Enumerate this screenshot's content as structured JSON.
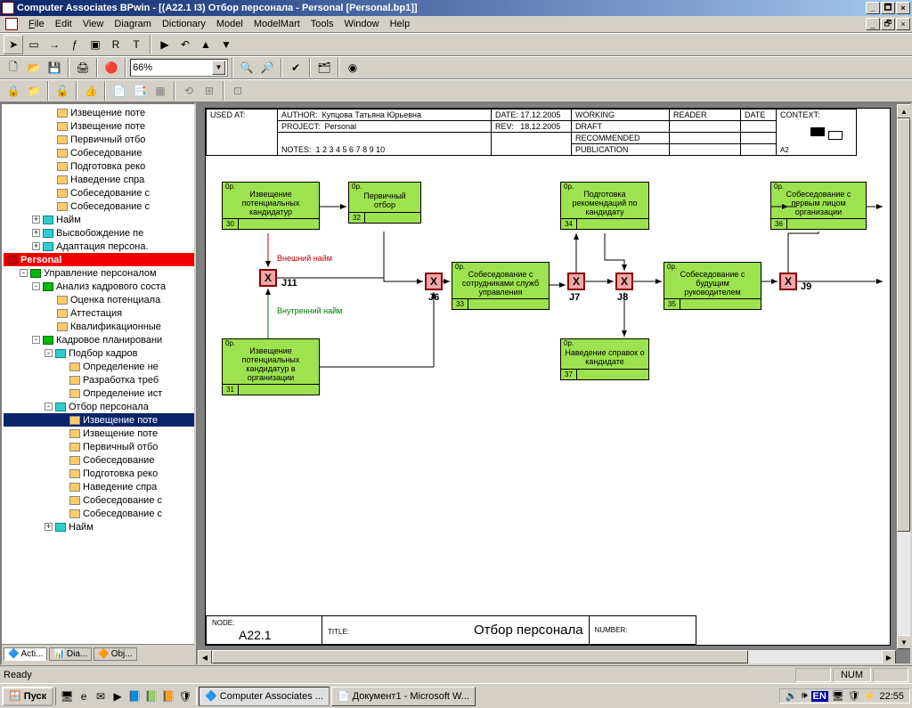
{
  "title": "Computer Associates BPwin - [(A22.1 I3) Отбор персонала - Personal  [Personal.bp1]]",
  "menu": {
    "file": "File",
    "edit": "Edit",
    "view": "View",
    "diagram": "Diagram",
    "dictionary": "Dictionary",
    "model": "Model",
    "modelmart": "ModelMart",
    "tools": "Tools",
    "window": "Window",
    "help": "Help"
  },
  "zoom": "66%",
  "status": {
    "ready": "Ready",
    "num": "NUM"
  },
  "sidebar_tabs": {
    "acti": "Acti...",
    "dia": "Dia...",
    "obj": "Obj..."
  },
  "tree": [
    {
      "indent": 60,
      "icon": "y",
      "label": "Извещение поте"
    },
    {
      "indent": 60,
      "icon": "y",
      "label": "Извещение поте"
    },
    {
      "indent": 60,
      "icon": "y",
      "label": "Первичный отбо"
    },
    {
      "indent": 60,
      "icon": "y",
      "label": "Собеседование"
    },
    {
      "indent": 60,
      "icon": "y",
      "label": "Подготовка реко"
    },
    {
      "indent": 60,
      "icon": "y",
      "label": "Наведение спра"
    },
    {
      "indent": 60,
      "icon": "y",
      "label": "Собеседование с"
    },
    {
      "indent": 60,
      "icon": "y",
      "label": "Собеседование с"
    },
    {
      "indent": 32,
      "pm": "+",
      "icon": "c",
      "label": "Найм"
    },
    {
      "indent": 32,
      "pm": "+",
      "icon": "c",
      "label": "Высвобождение пе"
    },
    {
      "indent": 32,
      "pm": "+",
      "icon": "c",
      "label": "Адаптация персона."
    },
    {
      "indent": 4,
      "icon": "r",
      "label": "Personal",
      "selred": true
    },
    {
      "indent": 18,
      "pm": "-",
      "icon": "g",
      "label": "Управление персоналом"
    },
    {
      "indent": 32,
      "pm": "-",
      "icon": "g",
      "label": "Анализ кадрового соста"
    },
    {
      "indent": 60,
      "icon": "y",
      "label": "Оценка потенциала"
    },
    {
      "indent": 60,
      "icon": "y",
      "label": "Аттестация"
    },
    {
      "indent": 60,
      "icon": "y",
      "label": "Квалификационные"
    },
    {
      "indent": 32,
      "pm": "-",
      "icon": "g",
      "label": "Кадровое планировани"
    },
    {
      "indent": 46,
      "pm": "-",
      "icon": "c",
      "label": "Подбор кадров"
    },
    {
      "indent": 74,
      "icon": "y",
      "label": "Определение не"
    },
    {
      "indent": 74,
      "icon": "y",
      "label": "Разработка треб"
    },
    {
      "indent": 74,
      "icon": "y",
      "label": "Определение ист"
    },
    {
      "indent": 46,
      "pm": "-",
      "icon": "c",
      "label": "Отбор персонала"
    },
    {
      "indent": 74,
      "icon": "y",
      "label": "Извещение поте",
      "sel": true
    },
    {
      "indent": 74,
      "icon": "y",
      "label": "Извещение поте"
    },
    {
      "indent": 74,
      "icon": "y",
      "label": "Первичный отбо"
    },
    {
      "indent": 74,
      "icon": "y",
      "label": "Собеседование"
    },
    {
      "indent": 74,
      "icon": "y",
      "label": "Подготовка реко"
    },
    {
      "indent": 74,
      "icon": "y",
      "label": "Наведение спра"
    },
    {
      "indent": 74,
      "icon": "y",
      "label": "Собеседование с"
    },
    {
      "indent": 74,
      "icon": "y",
      "label": "Собеседование с"
    },
    {
      "indent": 46,
      "pm": "+",
      "icon": "c",
      "label": "Найм"
    }
  ],
  "header": {
    "used_at": "USED AT:",
    "author_lbl": "AUTHOR:",
    "author": "Купцова Татьяна Юрьевна",
    "project_lbl": "PROJECT:",
    "project": "Personal",
    "notes_lbl": "NOTES:",
    "notes": "1  2  3  4  5  6  7  8  9  10",
    "date_lbl": "DATE:",
    "date": "17.12.2005",
    "rev_lbl": "REV:",
    "rev": "18.12.2005",
    "working": "WORKING",
    "draft": "DRAFT",
    "recommended": "RECOMMENDED",
    "publication": "PUBLICATION",
    "reader": "READER",
    "hdate": "DATE",
    "context": "CONTEXT:",
    "ctx_code": "A2"
  },
  "footer": {
    "node_lbl": "NODE:",
    "node": "A22.1",
    "title_lbl": "TITLE:",
    "title": "Отбор персонала",
    "number_lbl": "NUMBER:"
  },
  "activities": {
    "a30": {
      "tag": "0р.",
      "text": "Извещение потенциальных кандидатур",
      "num": "30"
    },
    "a31": {
      "tag": "0р.",
      "text": "Извещение потенциальных кандидатур в организации",
      "num": "31"
    },
    "a32": {
      "tag": "0р.",
      "text": "Первичный отбор",
      "num": "32"
    },
    "a33": {
      "tag": "0р.",
      "text": "Собеседование с сотрудниками служб управления",
      "num": "33"
    },
    "a34": {
      "tag": "0р.",
      "text": "Подготовка рекомендаций по кандидату",
      "num": "34"
    },
    "a35": {
      "tag": "0р.",
      "text": "Собеседование с будущим руководителем",
      "num": "35"
    },
    "a36": {
      "tag": "0р.",
      "text": "Собеседование с первым лицом организации",
      "num": "36"
    },
    "a37": {
      "tag": "0р.",
      "text": "Наведение справок о кандидате",
      "num": "37"
    }
  },
  "junctions": {
    "j11": "J11",
    "j6": "J6",
    "j7": "J7",
    "j8": "J8",
    "j9": "J9",
    "x": "X"
  },
  "labels": {
    "ext": "Внешний найм",
    "int": "Внутренний найм"
  },
  "taskbar": {
    "start": "Пуск",
    "task1": "Computer Associates ...",
    "task2": "Документ1 - Microsoft W...",
    "clock": "22:55",
    "lang": "EN"
  }
}
